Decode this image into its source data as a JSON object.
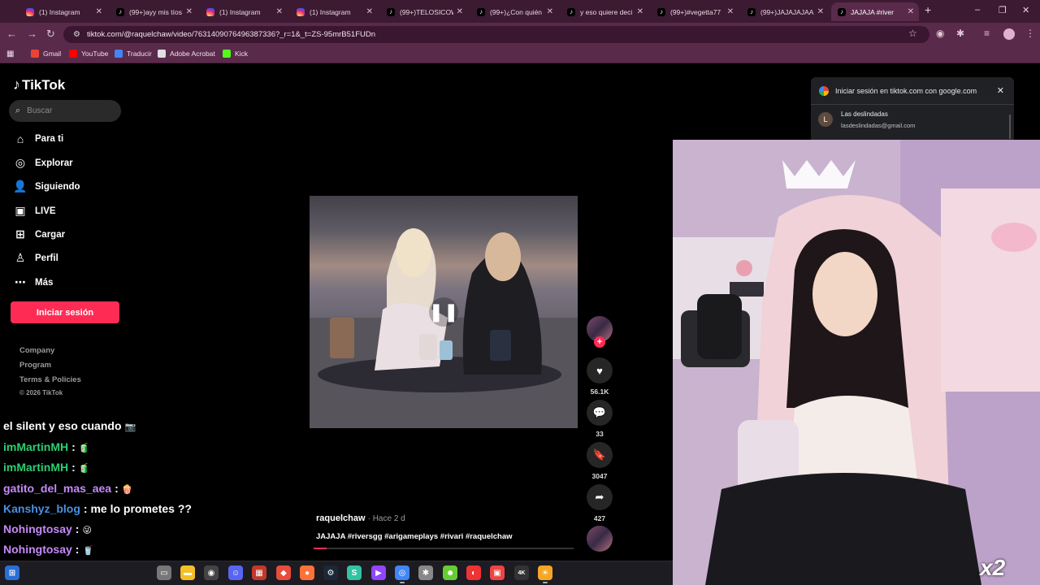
{
  "browser": {
    "tabs": [
      {
        "title": "(1) Instagram",
        "icon": "instagram-icon",
        "active": false
      },
      {
        "title": "(99+)ayy mis tíos",
        "icon": "tiktok-icon",
        "active": false
      },
      {
        "title": "(1) Instagram",
        "icon": "instagram-icon",
        "active": false
      },
      {
        "title": "(1) Instagram",
        "icon": "instagram-icon",
        "active": false
      },
      {
        "title": "(99+)TELOSICOW",
        "icon": "tiktok-icon",
        "active": false
      },
      {
        "title": "(99+)¿Con quién",
        "icon": "tiktok-icon",
        "active": false
      },
      {
        "title": "y eso quiere deci",
        "icon": "tiktok-icon",
        "active": false
      },
      {
        "title": "(99+)#vegetta77",
        "icon": "tiktok-icon",
        "active": false
      },
      {
        "title": "(99+)JAJAJAJAA",
        "icon": "tiktok-icon",
        "active": false
      },
      {
        "title": "JAJAJA #river",
        "icon": "tiktok-icon",
        "active": true
      }
    ],
    "new_tab": "+",
    "window_controls": {
      "minimize": "–",
      "restore": "❐",
      "close": "✕"
    },
    "url": "tiktok.com/@raquelchaw/video/7631409076496387336?_r=1&_t=ZS-95mrB51FUDn",
    "bookmarks": [
      {
        "label": "Gmail",
        "icon": "gmail-icon",
        "color": "#ea4335"
      },
      {
        "label": "YouTube",
        "icon": "youtube-icon",
        "color": "#ff0000"
      },
      {
        "label": "Traducir",
        "icon": "translate-icon",
        "color": "#4285f4"
      },
      {
        "label": "Adobe Acrobat",
        "icon": "acrobat-icon",
        "color": "#e0e0e0"
      },
      {
        "label": "Kick",
        "icon": "kick-icon",
        "color": "#53fc18"
      }
    ]
  },
  "tiktok": {
    "logo": "TikTok",
    "search_placeholder": "Buscar",
    "nav": [
      {
        "label": "Para ti",
        "icon": "home-icon"
      },
      {
        "label": "Explorar",
        "icon": "compass-icon"
      },
      {
        "label": "Siguiendo",
        "icon": "following-icon"
      },
      {
        "label": "LIVE",
        "icon": "live-icon"
      },
      {
        "label": "Cargar",
        "icon": "upload-icon"
      },
      {
        "label": "Perfil",
        "icon": "profile-icon"
      },
      {
        "label": "Más",
        "icon": "more-icon"
      }
    ],
    "login_button": "Iniciar sesión",
    "footer": [
      "Company",
      "Program",
      "Terms & Policies",
      "© 2026 TikTok"
    ],
    "video": {
      "author": "raquelchaw",
      "posted": "· Hace 2 d",
      "caption": "JAJAJA #riversgg #arigameplays #rivari #raquelchaw",
      "progress": 0.05,
      "state": "paused"
    },
    "actions": {
      "likes": "56.1K",
      "comments": "33",
      "saves": "3047",
      "shares": "427"
    }
  },
  "google_signin": {
    "title": "Iniciar sesión en tiktok.com con google.com",
    "account_initial": "L",
    "account_name": "Las deslindadas",
    "account_email": "lasdeslindadas@gmail.com"
  },
  "chat": [
    {
      "user": "",
      "message": "el silent y eso cuando",
      "color": "#ffffff"
    },
    {
      "user": "imMartinMH",
      "message": ":",
      "color": "#2ecc71"
    },
    {
      "user": "imMartinMH",
      "message": ":",
      "color": "#2ecc71"
    },
    {
      "user": "gatito_del_mas_aea",
      "message": ":",
      "color": "#c58af9"
    },
    {
      "user": "Kanshyz_blog",
      "message": ": me lo prometes ??",
      "color": "#4a90e2"
    },
    {
      "user": "Nohingtosay",
      "message": ":",
      "color": "#c58af9"
    },
    {
      "user": "Nohingtosay",
      "message": ":",
      "color": "#c58af9"
    }
  ],
  "overlay": {
    "multiplier": "x2"
  },
  "taskbar": [
    {
      "icon": "start-icon",
      "color": "#2a6fd6"
    },
    {
      "icon": "taskview-icon",
      "color": "#777"
    },
    {
      "icon": "explorer-icon",
      "color": "#f2c028"
    },
    {
      "icon": "obs-icon",
      "color": "#444"
    },
    {
      "icon": "discord-icon",
      "color": "#5865f2"
    },
    {
      "icon": "app-icon",
      "color": "#c0392b"
    },
    {
      "icon": "anydesk-icon",
      "color": "#e74c3c"
    },
    {
      "icon": "firefox-icon",
      "color": "#ff7139"
    },
    {
      "icon": "steam-icon",
      "color": "#1b2838"
    },
    {
      "icon": "streamlabs-icon",
      "color": "#31c3a2"
    },
    {
      "icon": "twitch-icon",
      "color": "#9146ff"
    },
    {
      "icon": "chrome-icon",
      "color": "#4285f4"
    },
    {
      "icon": "settings-icon",
      "color": "#888"
    },
    {
      "icon": "ghost-icon",
      "color": "#6c3"
    },
    {
      "icon": "recorder-icon",
      "color": "#e33"
    },
    {
      "icon": "screen-icon",
      "color": "#e44"
    },
    {
      "icon": "4k-icon",
      "color": "#333"
    },
    {
      "icon": "sun-app-icon",
      "color": "#f5a623"
    }
  ]
}
